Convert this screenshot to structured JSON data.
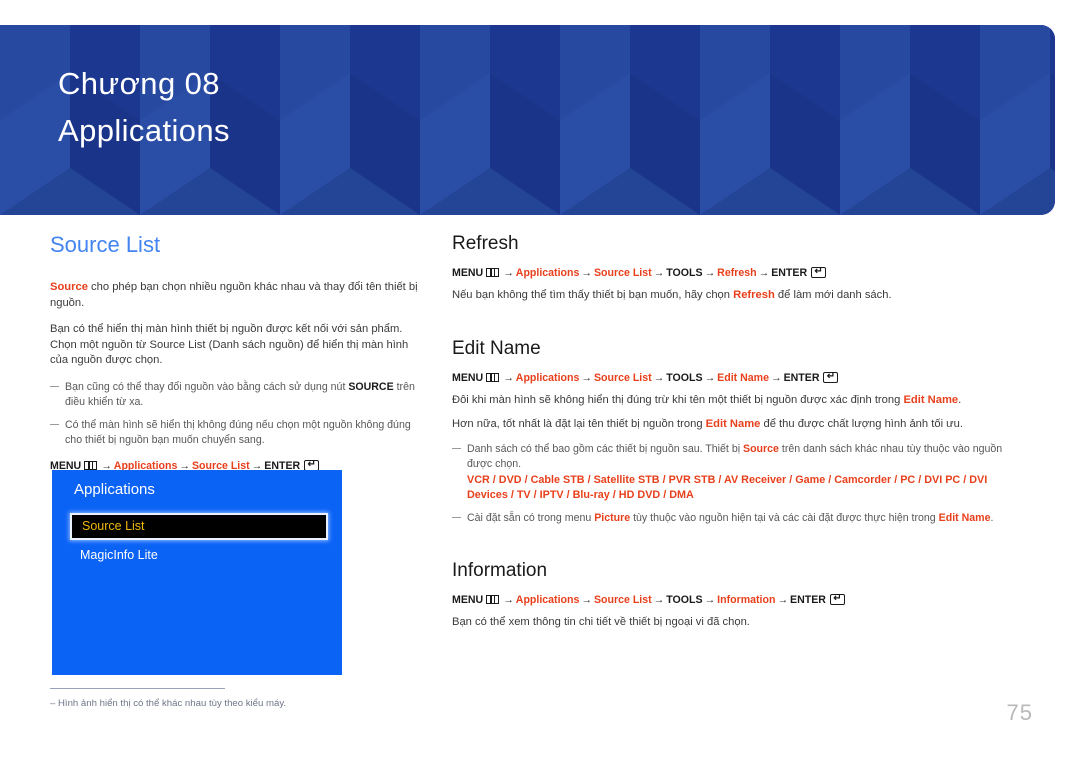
{
  "banner": {
    "chapter_label": "Chương 08",
    "chapter_title": "Applications",
    "bg_color": "#1f3d99"
  },
  "left_column": {
    "heading": "Source List",
    "heading_color": "#4384f0",
    "paragraph1": {
      "highlight": "Source",
      "rest": " cho phép bạn chọn nhiều nguồn khác nhau và thay đổi tên thiết bị nguồn."
    },
    "paragraph2": "Bạn có thể hiển thị màn hình thiết bị nguồn được kết nối với sản phẩm. Chọn một nguồn từ Source List (Danh sách nguồn) để hiển thị màn hình của nguồn được chọn.",
    "notes": [
      {
        "text_before": "Bạn cũng có thể thay đổi nguồn vào bằng cách sử dụng nút ",
        "bold": "SOURCE",
        "text_after": " trên điều khiển từ xa."
      },
      {
        "text_before": "Có thể màn hình sẽ hiển thị không đúng nếu chọn một nguồn không đúng cho thiết bị nguồn bạn muốn chuyển sang.",
        "bold": "",
        "text_after": ""
      }
    ],
    "path": {
      "menu": "MENU",
      "menu_icon": "menu-icon",
      "steps": [
        "Applications",
        "Source List"
      ],
      "enter": "ENTER",
      "enter_icon": "enter-icon"
    },
    "osd": {
      "title": "Applications",
      "items": [
        {
          "label": "Source List",
          "selected": true
        },
        {
          "label": "MagicInfo Lite",
          "selected": false
        }
      ],
      "bg_color": "#0b63f6",
      "selected_text_color": "#f0b80a"
    },
    "footnote": "Hình ảnh hiển thị có thể khác nhau tùy theo kiểu máy."
  },
  "right_column": {
    "sections": [
      {
        "heading": "Refresh",
        "path_steps": [
          "Applications",
          "Source List",
          "TOOLS",
          "Refresh"
        ],
        "path_plain_steps": [
          "TOOLS"
        ],
        "body": {
          "before": "Nếu bạn không thể tìm thấy thiết bị bạn muốn, hãy chọn ",
          "highlight": "Refresh",
          "after": " để làm mới danh sách."
        }
      },
      {
        "heading": "Edit Name",
        "path_steps": [
          "Applications",
          "Source List",
          "TOOLS",
          "Edit Name"
        ],
        "body1": {
          "before": "Đôi khi màn hình sẽ không hiển thị đúng trừ khi tên một thiết bị nguồn được xác định trong ",
          "highlight": "Edit Name",
          "after": "."
        },
        "body2": {
          "before": "Hơn nữa, tốt nhất là đặt lại tên thiết bị nguồn trong ",
          "highlight": "Edit Name",
          "after": " để thu được chất lượng hình ảnh tối ưu."
        },
        "notes": [
          {
            "before": "Danh sách có thể bao gồm các thiết bị nguồn sau. Thiết bị ",
            "highlight": "Source",
            "after": " trên danh sách khác nhau tùy thuộc vào nguồn được chọn.",
            "devices": [
              "VCR",
              "DVD",
              "Cable STB",
              "Satellite STB",
              "PVR STB",
              "AV Receiver",
              "Game",
              "Camcorder",
              "PC",
              "DVI PC",
              "DVI Devices",
              "TV",
              "IPTV",
              "Blu-ray",
              "HD DVD",
              "DMA"
            ]
          },
          {
            "before": "Cài đặt sẵn có trong menu ",
            "highlight": "Picture",
            "middle": " tùy thuộc vào nguồn hiện tại và các cài đặt được thực hiện trong ",
            "highlight2": "Edit Name",
            "after": "."
          }
        ]
      },
      {
        "heading": "Information",
        "path_steps": [
          "Applications",
          "Source List",
          "TOOLS",
          "Information"
        ],
        "body": "Bạn có thể xem thông tin chi tiết về thiết bị ngoại vi đã chọn."
      }
    ]
  },
  "page_number": "75",
  "colors": {
    "accent_red": "#e8401c",
    "heading_blue": "#4384f0",
    "banner_blue": "#1f3d99"
  }
}
